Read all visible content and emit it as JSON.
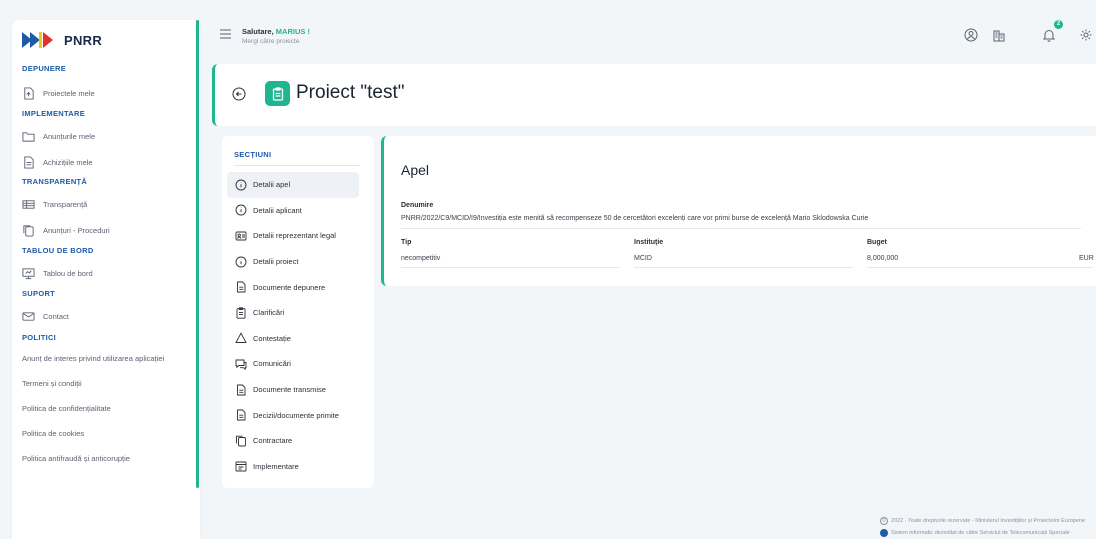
{
  "app": {
    "logo_text": "PNRR"
  },
  "colors": {
    "accent": "#1fb58f",
    "section_blue": "#1e5aa8",
    "logo_blue": "#1e5aa8",
    "logo_red": "#e0322b",
    "logo_yellow": "#f5c518"
  },
  "sidebar": {
    "depunere": {
      "heading": "DEPUNERE",
      "items": [
        {
          "label": "Proiectele mele",
          "icon": "document-upload-icon"
        }
      ]
    },
    "implementare": {
      "heading": "IMPLEMENTARE",
      "items": [
        {
          "label": "Anunțurile mele",
          "icon": "folder-icon"
        },
        {
          "label": "Achizițiile mele",
          "icon": "document-icon"
        }
      ]
    },
    "transparenta": {
      "heading": "TRANSPARENȚĂ",
      "items": [
        {
          "label": "Transparență",
          "icon": "table-icon"
        },
        {
          "label": "Anunțuri - Proceduri",
          "icon": "copy-icon"
        }
      ]
    },
    "tablou": {
      "heading": "TABLOU DE BORD",
      "items": [
        {
          "label": "Tablou de bord",
          "icon": "dashboard-icon"
        }
      ]
    },
    "suport": {
      "heading": "SUPORT",
      "items": [
        {
          "label": "Contact",
          "icon": "mail-icon"
        }
      ]
    },
    "politici": {
      "heading": "POLITICI",
      "items": [
        "Anunț de interes privind utilizarea aplicației",
        "Termeni și condiții",
        "Politica de confidențialitate",
        "Politica de cookies",
        "Politica antifraudă și anticorupție"
      ]
    }
  },
  "topbar": {
    "greeting": "Salutare,",
    "user": "MARIUS !",
    "subtitle": "Mergi către proiecte",
    "notifications": "2"
  },
  "header": {
    "title": "Proiect \"test\""
  },
  "sections": {
    "heading": "SECȚIUNI",
    "items": [
      {
        "label": "Detalii apel",
        "icon": "info-icon",
        "active": true
      },
      {
        "label": "Detalii aplicant",
        "icon": "info-icon"
      },
      {
        "label": "Detalii reprezentant legal",
        "icon": "id-card-icon"
      },
      {
        "label": "Detalii proiect",
        "icon": "info-icon"
      },
      {
        "label": "Documente depunere",
        "icon": "document-icon"
      },
      {
        "label": "Clarificări",
        "icon": "clipboard-icon"
      },
      {
        "label": "Contestație",
        "icon": "warning-icon"
      },
      {
        "label": "Comunicări",
        "icon": "chat-icon"
      },
      {
        "label": "Documente transmise",
        "icon": "document-icon"
      },
      {
        "label": "Decizii/documente primite",
        "icon": "document-icon"
      },
      {
        "label": "Contractare",
        "icon": "copy-icon"
      },
      {
        "label": "Implementare",
        "icon": "calendar-icon"
      }
    ]
  },
  "apel": {
    "title": "Apel",
    "denumire_label": "Denumire",
    "denumire_value": "PNRR/2022/C9/MCID/I9/Investiția este menită să recompenseze 50 de cercetători excelenți care vor primi burse de excelență Mario Sklodowska Curie",
    "tip_label": "Tip",
    "tip_value": "necompetitiv",
    "institutie_label": "Instituție",
    "institutie_value": "MCID",
    "buget_label": "Buget",
    "buget_value": "8,000,000",
    "currency": "EUR"
  },
  "footer": {
    "line1": "2022 · Toate drepturile rezervate - Ministerul Investițiilor și Proiectelor Europene",
    "line2": "Sistem informatic dezvoltat de către Serviciul de Telecomunicații Speciale"
  }
}
